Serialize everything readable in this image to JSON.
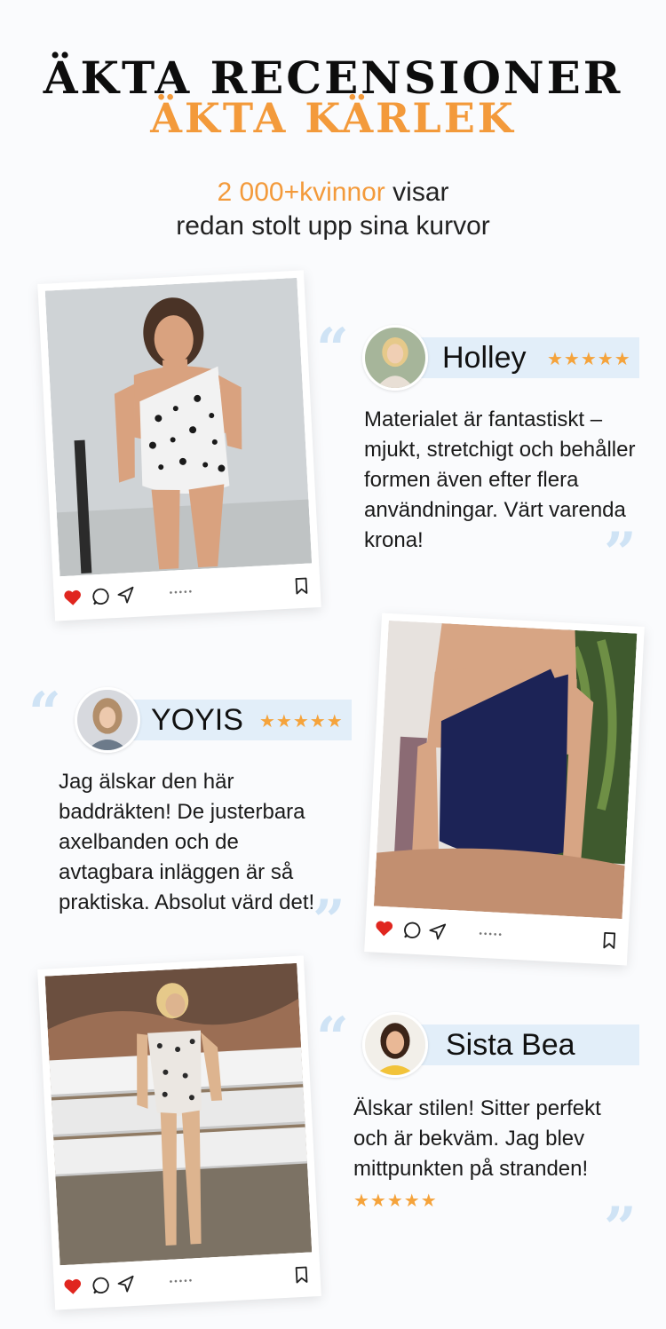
{
  "header": {
    "line1": "ÄKTA RECENSIONER",
    "line2": "ÄKTA KÄRLEK"
  },
  "intro": {
    "highlight": "2 000+kvinnor",
    "rest1": " visar",
    "line2": "redan stolt upp sina kurvor"
  },
  "reviews": [
    {
      "name": "Holley",
      "stars": "★★★★★",
      "text": "Materialet är fantastiskt – mjukt, stretchigt och behåller formen även efter flera användningar. Värt varenda krona!"
    },
    {
      "name": "YOYIS",
      "stars": "★★★★★",
      "text": "Jag älskar den här baddräkten! De justerbara axelbanden och de avtagbara inläggen är så praktiska. Absolut värd det!"
    },
    {
      "name": "Sista Bea",
      "stars": "★★★★★",
      "text": "Älskar stilen! Sitter perfekt och är bekväm. Jag blev mittpunkten på stranden!"
    }
  ],
  "quote_open": "“",
  "quote_close": "”",
  "post_dots": "•••••",
  "colors": {
    "accent": "#f39a3b",
    "band": "#e2eef9",
    "quote": "#cfe3f5",
    "heart": "#e0261f",
    "navy_swimsuit": "#1c2356"
  },
  "icons": [
    "heart-icon",
    "comment-icon",
    "share-icon",
    "bookmark-icon",
    "quote-icon",
    "star-icon"
  ]
}
